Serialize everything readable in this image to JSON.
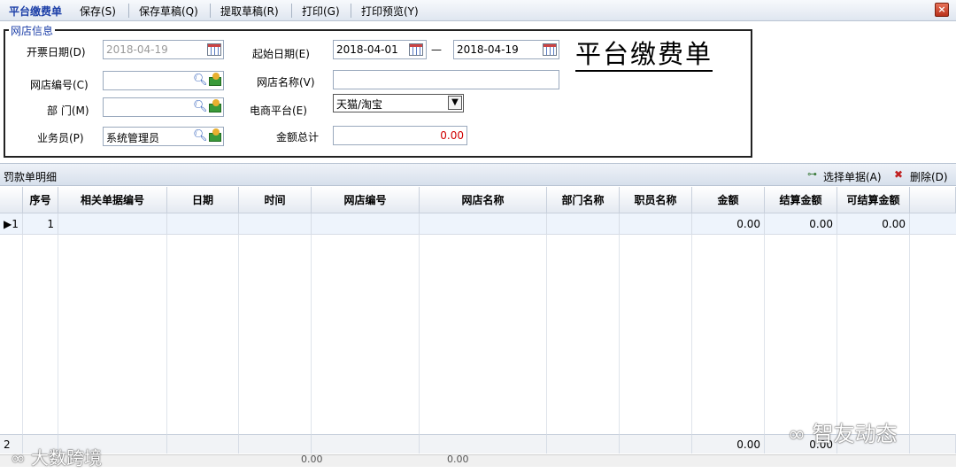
{
  "toolbar": {
    "title": "平台缴费单",
    "save": "保存(S)",
    "save_draft": "保存草稿(Q)",
    "fetch_draft": "提取草稿(R)",
    "print": "打印(G)",
    "print_preview": "打印预览(Y)",
    "close_icon": "close-icon"
  },
  "shop_info": {
    "group_title": "网店信息",
    "invoice_date_label": "开票日期(D)",
    "invoice_date_value": "2018-04-19",
    "start_date_label": "起始日期(E)",
    "start_date_value": "2018-04-01",
    "date_separator": "—",
    "end_date_value": "2018-04-19",
    "shop_code_label": "网店编号(C)",
    "shop_code_value": "",
    "shop_name_label": "网店名称(V)",
    "shop_name_value": "",
    "dept_label": "部 门(M)",
    "dept_value": "",
    "platform_label": "电商平台(E)",
    "platform_value": "天猫/淘宝",
    "salesman_label": "业务员(P)",
    "salesman_value": "系统管理员",
    "total_label": "金额总计",
    "total_value": "0.00",
    "form_title": "平台缴费单"
  },
  "detail": {
    "title": "罚款单明细",
    "select_doc": "选择单据(A)",
    "delete": "删除(D)",
    "columns": [
      "序号",
      "相关单据编号",
      "日期",
      "时间",
      "网店编号",
      "网店名称",
      "部门名称",
      "职员名称",
      "金额",
      "结算金额",
      "可结算金额"
    ],
    "rows": [
      {
        "row_marker": "1",
        "seq": "1",
        "doc_no": "",
        "date": "",
        "time": "",
        "shop_code": "",
        "shop_name": "",
        "dept": "",
        "staff": "",
        "amount": "0.00",
        "settled": "0.00",
        "settleable": "0.00"
      }
    ],
    "footer": {
      "row_marker": "2",
      "amount": "0.00",
      "settled": "0.00"
    },
    "bottom_partial": [
      "0.00",
      "0.00"
    ]
  },
  "watermarks": {
    "left": "大数跨境",
    "right": "智友动态"
  }
}
